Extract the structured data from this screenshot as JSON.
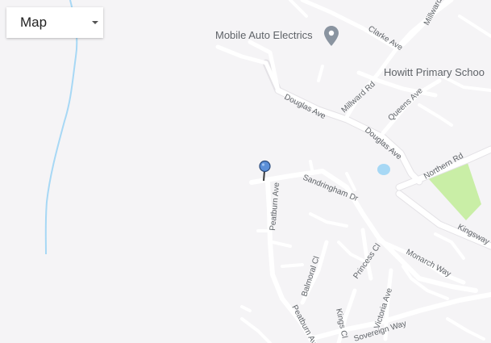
{
  "map_type": {
    "selected": "Map"
  },
  "pois": {
    "mobile_auto": {
      "label": "Mobile Auto Electrics",
      "icon": "location-pin-icon"
    },
    "school": {
      "label": "Howitt Primary Schoo",
      "icon": "school-icon"
    }
  },
  "streets": {
    "clarke_ave": "Clarke Ave",
    "millward_rd_top": "Millward Rd",
    "millward_rd": "Millward Rd",
    "queens_ave": "Queens Ave",
    "douglas_ave_1": "Douglas Ave",
    "douglas_ave_2": "Douglas Ave",
    "northern_rd": "Northern Rd",
    "kingsway": "Kingsway",
    "sandringham_dr": "Sandringham Dr",
    "peatburn_ave_1": "Peatburn Ave",
    "peatburn_ave_2": "Peatburn Ave",
    "balmoral_cl": "Balmoral Cl",
    "princess_cl": "Princess Cl",
    "monarch_way": "Monarch Way",
    "victoria_ave": "Victoria Ave",
    "kings_cl": "Kings Cl",
    "sovereign_way": "Sovereign Way"
  },
  "marker": {
    "icon": "map-marker-icon",
    "color": "#5b8fd8"
  },
  "colors": {
    "water": "#a7d8f5",
    "park": "#c9eea6",
    "road": "#ffffff",
    "land": "#f5f4f6"
  }
}
